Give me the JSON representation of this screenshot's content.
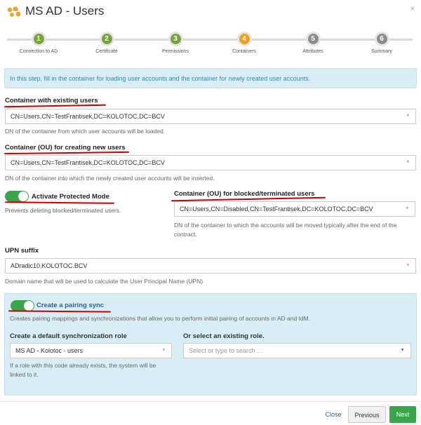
{
  "header": {
    "title": "MS AD - Users",
    "close": "×"
  },
  "steps": [
    {
      "num": "1",
      "label": "Connection to AD",
      "color": "#77a33a"
    },
    {
      "num": "2",
      "label": "Certificate",
      "color": "#77a33a"
    },
    {
      "num": "3",
      "label": "Permissions",
      "color": "#77a33a"
    },
    {
      "num": "4",
      "label": "Containers",
      "color": "#f0a01f"
    },
    {
      "num": "5",
      "label": "Attributes",
      "color": "#8c8c8c"
    },
    {
      "num": "6",
      "label": "Summary",
      "color": "#8c8c8c"
    }
  ],
  "info": "In this step, fill in the container for loading user accounts and the container for newly created user accounts.",
  "existing": {
    "label": "Container with existing users",
    "value": "CN=Users,CN=TestFrantisek,DC=KOLOTOC,DC=BCV",
    "help": "DN of the container from which user accounts will be loaded."
  },
  "new_users": {
    "label": "Container (OU) for creating new users",
    "value": "CN=Users,CN=TestFrantisek,DC=KOLOTOC,DC=BCV",
    "help": "DN of the container into which the newly created user accounts will be inserted."
  },
  "protected": {
    "label": "Activate Protected Mode",
    "help": "Prevents deleting blocked/terminated users."
  },
  "blocked": {
    "label": "Container (OU) for blocked/terminated users",
    "value": "CN=Users,CN=Disabled,CN=TestFrantisek,DC=KOLOTOC,DC=BCV",
    "help": "DN of the container to which the accounts will be moved typically after the end of the contract."
  },
  "upn": {
    "label": "UPN suffix",
    "value": "ADradic10.KOLOTOC.BCV",
    "help": "Domain name that will be used to calculate the User Principal Name (UPN)"
  },
  "sync": {
    "label": "Create a pairing sync",
    "help": "Creates pairing mappings and synchronizations that allow you to perform initial pairing of accounts in AD and IdM.",
    "role_label": "Create a default synchronization role",
    "role_value": "MS AD - Kolotoc - users",
    "role_help": "If a role with this code already exists, the system will be linked to it.",
    "existing_label": "Or select an existing role.",
    "existing_placeholder": "Select or type to search ..."
  },
  "required_mark": "*",
  "footer": {
    "close": "Close",
    "previous": "Previous",
    "next": "Next"
  },
  "colors": {
    "accent": "#3aa54a",
    "info_bg": "#d9edf7",
    "annotation": "#cc0000"
  }
}
